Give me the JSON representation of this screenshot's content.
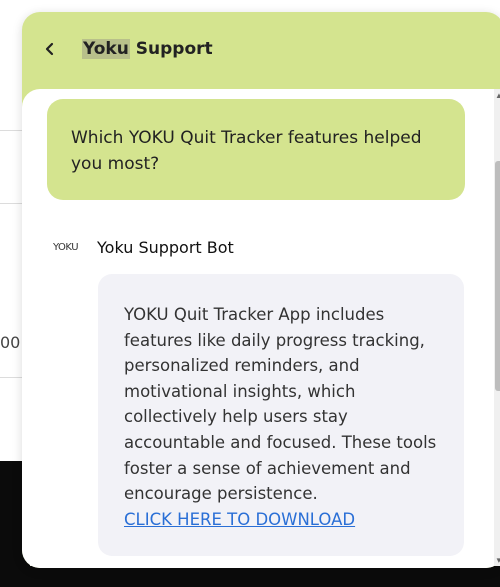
{
  "background": {
    "partial_value": "00"
  },
  "chat": {
    "title_highlight": "Yoku",
    "title_rest": " Support",
    "back_icon": "chevron-left-icon",
    "messages": [
      {
        "role": "user",
        "text": "Which YOKU Quit Tracker features helped you most?"
      },
      {
        "role": "bot",
        "logo_text": "YOKU",
        "sender": "Yoku Support Bot",
        "text": "YOKU Quit Tracker App includes features like daily progress tracking, personalized reminders, and motivational insights, which collectively help users stay accountable and focused. These tools foster a sense of achievement and encourage persistence.",
        "link_text": "CLICK HERE TO DOWNLOAD"
      }
    ]
  },
  "colors": {
    "accent": "#d4e48f",
    "bot_bubble": "#f2f2f7",
    "link": "#2a6fd6"
  }
}
